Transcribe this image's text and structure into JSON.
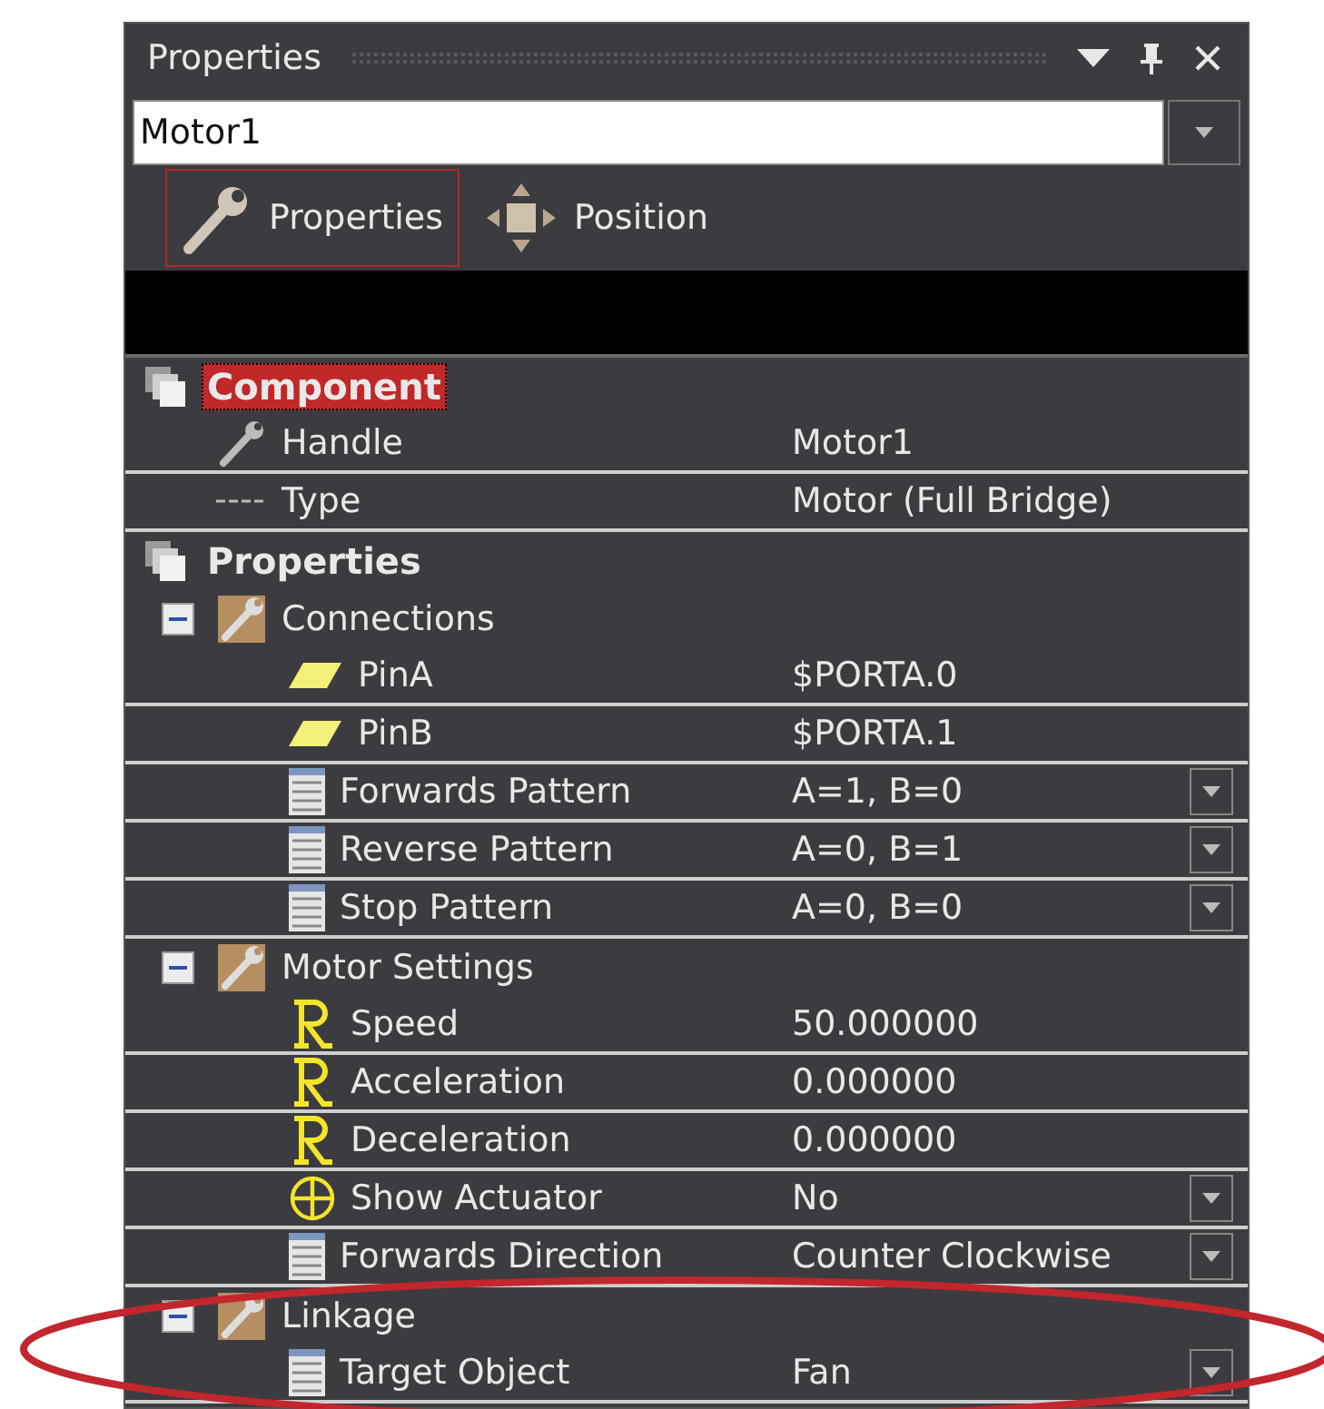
{
  "window": {
    "title": "Properties"
  },
  "object_field": {
    "value": "Motor1"
  },
  "tabs": [
    {
      "label": "Properties",
      "kind": "wrench",
      "selected": true
    },
    {
      "label": "Position",
      "kind": "move",
      "selected": false
    }
  ],
  "grid": [
    {
      "kind": "category",
      "label": "Component",
      "selected": true,
      "children": [
        {
          "kind": "handle",
          "label": "Handle",
          "value": "Motor1",
          "dropdown": false
        },
        {
          "kind": "type",
          "label": "Type",
          "value": "Motor (Full Bridge)",
          "dropdown": false
        }
      ]
    },
    {
      "kind": "category",
      "label": "Properties",
      "selected": false,
      "children": [
        {
          "kind": "group",
          "label": "Connections",
          "expanded": true,
          "children": [
            {
              "kind": "pin",
              "label": "PinA",
              "value": "$PORTA.0",
              "dropdown": false
            },
            {
              "kind": "pin",
              "label": "PinB",
              "value": "$PORTA.1",
              "dropdown": false
            },
            {
              "kind": "pattern",
              "label": "Forwards Pattern",
              "value": "A=1, B=0",
              "dropdown": true
            },
            {
              "kind": "pattern",
              "label": "Reverse Pattern",
              "value": "A=0, B=1",
              "dropdown": true
            },
            {
              "kind": "pattern",
              "label": "Stop Pattern",
              "value": "A=0, B=0",
              "dropdown": true
            }
          ]
        },
        {
          "kind": "group",
          "label": "Motor Settings",
          "expanded": true,
          "children": [
            {
              "kind": "real",
              "label": "Speed",
              "value": "50.000000",
              "dropdown": false
            },
            {
              "kind": "real",
              "label": "Acceleration",
              "value": "0.000000",
              "dropdown": false
            },
            {
              "kind": "real",
              "label": "Deceleration",
              "value": "0.000000",
              "dropdown": false
            },
            {
              "kind": "toggle",
              "label": "Show Actuator",
              "value": "No",
              "dropdown": true
            },
            {
              "kind": "pattern",
              "label": "Forwards Direction",
              "value": "Counter Clockwise",
              "dropdown": true
            }
          ]
        },
        {
          "kind": "group",
          "label": "Linkage",
          "expanded": true,
          "children": [
            {
              "kind": "pattern",
              "label": "Target Object",
              "value": "Fan",
              "dropdown": true
            }
          ]
        }
      ]
    }
  ]
}
